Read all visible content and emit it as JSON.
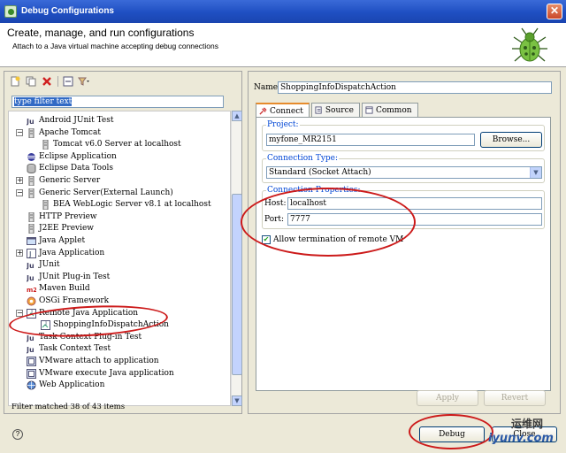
{
  "window": {
    "title": "Debug Configurations"
  },
  "header": {
    "title": "Create, manage, and run configurations",
    "description": "Attach to a Java virtual machine accepting debug connections"
  },
  "left": {
    "filter_text": "type filter text",
    "tree": [
      {
        "label": "Android JUnit Test",
        "level": 1,
        "icon": "junit-icon"
      },
      {
        "label": "Apache Tomcat",
        "level": 1,
        "expander": "−",
        "icon": "server-icon"
      },
      {
        "label": "Tomcat v6.0 Server at localhost",
        "level": 2,
        "icon": "server-icon"
      },
      {
        "label": "Eclipse Application",
        "level": 1,
        "icon": "eclipse-icon"
      },
      {
        "label": "Eclipse Data Tools",
        "level": 1,
        "icon": "database-icon"
      },
      {
        "label": "Generic Server",
        "level": 1,
        "expander": "+",
        "icon": "server-icon"
      },
      {
        "label": "Generic Server(External Launch)",
        "level": 1,
        "expander": "−",
        "icon": "server-icon"
      },
      {
        "label": "BEA WebLogic Server v8.1 at localhost",
        "level": 2,
        "icon": "server-icon"
      },
      {
        "label": "HTTP Preview",
        "level": 1,
        "icon": "server-icon"
      },
      {
        "label": "J2EE Preview",
        "level": 1,
        "icon": "server-icon"
      },
      {
        "label": "Java Applet",
        "level": 1,
        "icon": "applet-icon"
      },
      {
        "label": "Java Application",
        "level": 1,
        "expander": "+",
        "icon": "java-app-icon"
      },
      {
        "label": "JUnit",
        "level": 1,
        "icon": "junit-icon"
      },
      {
        "label": "JUnit Plug-in Test",
        "level": 1,
        "icon": "junit-icon"
      },
      {
        "label": "Maven Build",
        "level": 1,
        "icon": "maven-icon"
      },
      {
        "label": "OSGi Framework",
        "level": 1,
        "icon": "osgi-icon"
      },
      {
        "label": "Remote Java Application",
        "level": 1,
        "expander": "−",
        "icon": "remote-java-icon"
      },
      {
        "label": "ShoppingInfoDispatchAction",
        "level": 2,
        "icon": "remote-java-icon"
      },
      {
        "label": "Task Context Plug-in Test",
        "level": 1,
        "icon": "junit-icon"
      },
      {
        "label": "Task Context Test",
        "level": 1,
        "icon": "junit-icon"
      },
      {
        "label": "VMware attach to application",
        "level": 1,
        "icon": "vmware-icon"
      },
      {
        "label": "VMware execute Java application",
        "level": 1,
        "icon": "vmware-icon"
      },
      {
        "label": "Web Application",
        "level": 1,
        "icon": "web-app-icon"
      }
    ],
    "matched": "Filter matched 38 of 43 items"
  },
  "right": {
    "name_label": "Name:",
    "name_value": "ShoppingInfoDispatchAction",
    "tabs": [
      {
        "label": "Connect",
        "active": true
      },
      {
        "label": "Source",
        "active": false
      },
      {
        "label": "Common",
        "active": false
      }
    ],
    "project_label": "Project:",
    "project_value": "myfone_MR2151",
    "browse": "Browse...",
    "conn_type_label": "Connection Type:",
    "conn_type_value": "Standard (Socket Attach)",
    "conn_props_label": "Connection Properties:",
    "host_label": "Host:",
    "host_value": "localhost",
    "port_label": "Port:",
    "port_value": "7777",
    "allow_term": "Allow termination of remote VM",
    "allow_term_checked": true,
    "apply": "Apply",
    "revert": "Revert"
  },
  "footer": {
    "debug": "Debug",
    "close": "Close"
  },
  "watermark": {
    "line1": "运维网",
    "line2": "iyunv.com"
  },
  "colors": {
    "title_bar": "#1f4fc2",
    "annotation": "#cc1a1a",
    "group_title": "#0046d5"
  }
}
